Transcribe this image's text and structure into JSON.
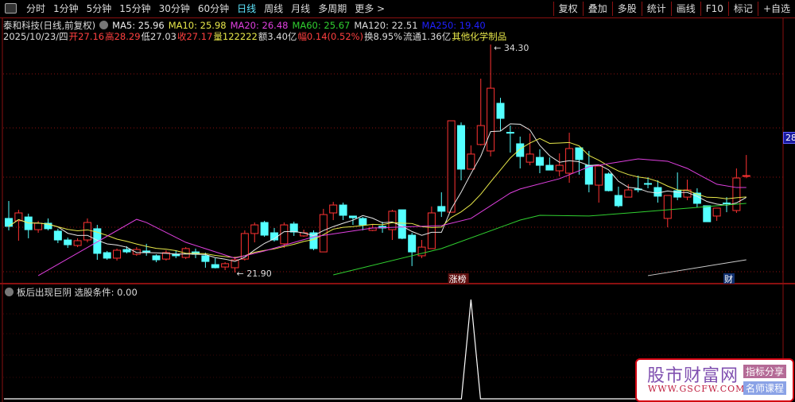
{
  "toolbar": {
    "tabs": [
      "分时",
      "1分钟",
      "5分钟",
      "15分钟",
      "30分钟",
      "60分钟",
      "日线",
      "周线",
      "月线",
      "多周期",
      "更多 >"
    ],
    "active_tab": "日线",
    "right_buttons": [
      "复权",
      "叠加",
      "多股",
      "统计",
      "画线",
      "F10",
      "标记",
      "+自选"
    ]
  },
  "header": {
    "title": "泰和科技(日线,前复权)",
    "ma5": "MA5: 25.96",
    "ma10": "MA10: 25.98",
    "ma20": "MA20: 26.48",
    "ma60": "MA60: 25.67",
    "ma120": "MA120: 22.51",
    "ma250": "MA250: 19.40",
    "date": "2025/10/23/四",
    "open": "开27.16",
    "high": "高28.29",
    "low": "低27.03",
    "close": "收27.17",
    "volume": "量122222",
    "amount": "额3.40亿",
    "change": "幅0.14(0.52%)",
    "turnover": "换8.95%",
    "float": "流通1.36亿",
    "industry": "其他化学制品"
  },
  "colors": {
    "up": "#ff3333",
    "down": "#54ffff",
    "ma5": "#e8e8e8",
    "ma10": "#e8e84a",
    "ma20": "#e040e0",
    "ma60": "#30d030",
    "ma120": "#cccccc",
    "ma250": "#2020ff",
    "grid": "#8a1010"
  },
  "chart_data": {
    "type": "candlestick",
    "price_labels": {
      "max": "34.30",
      "min": "21.90"
    },
    "current_price_tag": "28.",
    "candles": [
      [
        24.84,
        25.79,
        24.19,
        24.41
      ],
      [
        24.71,
        25.31,
        23.63,
        25.14
      ],
      [
        24.92,
        25.1,
        23.76,
        24.23
      ],
      [
        24.23,
        24.71,
        24.06,
        24.58
      ],
      [
        24.58,
        24.84,
        24.19,
        24.28
      ],
      [
        24.15,
        24.28,
        23.5,
        23.67
      ],
      [
        23.67,
        23.8,
        23.24,
        23.41
      ],
      [
        23.37,
        23.76,
        23.28,
        23.63
      ],
      [
        23.67,
        24.84,
        23.54,
        24.62
      ],
      [
        24.28,
        24.49,
        22.59,
        22.94
      ],
      [
        22.98,
        23.07,
        22.59,
        22.68
      ],
      [
        22.68,
        23.2,
        22.55,
        23.11
      ],
      [
        23.15,
        23.33,
        22.94,
        23.02
      ],
      [
        22.89,
        23.28,
        22.81,
        23.15
      ],
      [
        23.07,
        23.46,
        22.81,
        22.98
      ],
      [
        22.81,
        22.89,
        22.46,
        22.59
      ],
      [
        22.63,
        23.11,
        22.55,
        22.98
      ],
      [
        22.89,
        23.11,
        22.68,
        22.81
      ],
      [
        22.72,
        23.28,
        22.63,
        23.2
      ],
      [
        23.02,
        23.2,
        22.68,
        22.89
      ],
      [
        22.81,
        22.98,
        22.16,
        22.5
      ],
      [
        22.33,
        22.68,
        22.12,
        22.16
      ],
      [
        22.2,
        22.46,
        22.03,
        22.38
      ],
      [
        22.16,
        22.76,
        21.9,
        22.59
      ],
      [
        22.63,
        24.19,
        22.55,
        24.02
      ],
      [
        24.02,
        24.62,
        23.54,
        24.49
      ],
      [
        24.62,
        24.71,
        23.84,
        23.93
      ],
      [
        24.06,
        24.32,
        23.58,
        23.67
      ],
      [
        23.46,
        24.62,
        23.24,
        24.49
      ],
      [
        24.54,
        24.66,
        23.89,
        24.1
      ],
      [
        23.89,
        24.23,
        23.84,
        24.06
      ],
      [
        24.06,
        24.19,
        23.11,
        23.2
      ],
      [
        23.02,
        25.36,
        23.02,
        25.05
      ],
      [
        25.14,
        25.74,
        24.75,
        25.57
      ],
      [
        25.57,
        25.7,
        24.75,
        25.01
      ],
      [
        24.97,
        24.97,
        24.49,
        24.88
      ],
      [
        24.84,
        24.92,
        24.19,
        24.49
      ],
      [
        24.19,
        24.49,
        24.15,
        24.32
      ],
      [
        24.41,
        24.66,
        24.06,
        24.32
      ],
      [
        24.23,
        25.31,
        23.67,
        25.23
      ],
      [
        25.31,
        25.31,
        23.71,
        23.76
      ],
      [
        23.93,
        24.06,
        22.25,
        23.02
      ],
      [
        22.81,
        23.67,
        22.68,
        23.28
      ],
      [
        23.2,
        25.49,
        23.2,
        25.14
      ],
      [
        25.49,
        26.26,
        24.92,
        25.23
      ],
      [
        25.18,
        30.15,
        25.18,
        30.15
      ],
      [
        29.89,
        30.06,
        26.91,
        27.52
      ],
      [
        27.52,
        28.81,
        27.52,
        28.34
      ],
      [
        28.86,
        32.44,
        28.81,
        29.89
      ],
      [
        28.51,
        34.3,
        28.21,
        31.92
      ],
      [
        31.1,
        31.4,
        29.59,
        30.28
      ],
      [
        29.52,
        29.89,
        28.42,
        29.5
      ],
      [
        28.9,
        29.29,
        27.56,
        28.21
      ],
      [
        27.9,
        29.46,
        27.73,
        28.34
      ],
      [
        28.16,
        28.6,
        27.3,
        27.73
      ],
      [
        27.73,
        28.16,
        27.47,
        27.47
      ],
      [
        27.43,
        28.38,
        27.13,
        27.73
      ],
      [
        27.3,
        29.5,
        26.78,
        28.64
      ],
      [
        28.68,
        28.68,
        27.22,
        28.04
      ],
      [
        27.73,
        28.51,
        26.26,
        26.7
      ],
      [
        26.65,
        27.69,
        25.7,
        27.69
      ],
      [
        27.26,
        27.34,
        26.31,
        26.35
      ],
      [
        26.09,
        26.57,
        25.44,
        25.53
      ],
      [
        26.0,
        26.7,
        26.0,
        26.39
      ],
      [
        26.44,
        27.17,
        26.26,
        26.42
      ],
      [
        26.74,
        27.08,
        26.48,
        26.72
      ],
      [
        26.52,
        26.91,
        25.7,
        26.05
      ],
      [
        24.84,
        26.09,
        24.36,
        26.09
      ],
      [
        26.35,
        27.34,
        25.83,
        26.0
      ],
      [
        26.0,
        26.95,
        25.83,
        26.39
      ],
      [
        26.22,
        26.48,
        25.44,
        25.66
      ],
      [
        25.53,
        25.53,
        24.66,
        24.66
      ],
      [
        24.97,
        25.4,
        24.71,
        25.4
      ],
      [
        25.68,
        26.0,
        25.18,
        25.66
      ],
      [
        25.27,
        27.56,
        25.14,
        27.04
      ],
      [
        27.16,
        28.29,
        27.03,
        27.17
      ]
    ],
    "candle_format": [
      "open",
      "high",
      "low",
      "close"
    ],
    "ma20_points": [
      [
        3,
        21.73
      ],
      [
        13,
        24.79
      ],
      [
        14,
        24.62
      ],
      [
        18,
        23.54
      ],
      [
        23,
        22.68
      ],
      [
        26,
        23.07
      ],
      [
        31,
        23.84
      ],
      [
        37,
        24.32
      ],
      [
        44,
        24.45
      ],
      [
        47,
        24.84
      ],
      [
        51,
        26.22
      ],
      [
        52,
        26.44
      ],
      [
        56,
        27.0
      ],
      [
        59,
        27.65
      ],
      [
        64,
        28.08
      ],
      [
        67,
        27.95
      ],
      [
        69,
        27.56
      ],
      [
        72,
        26.7
      ],
      [
        74,
        26.52
      ],
      [
        75,
        26.52
      ]
    ],
    "ma60_points": [
      [
        33,
        21.77
      ],
      [
        44,
        23.2
      ],
      [
        52,
        24.75
      ],
      [
        54,
        25.01
      ],
      [
        59,
        24.97
      ],
      [
        64,
        25.18
      ],
      [
        75,
        25.66
      ]
    ],
    "ma120_points": [
      [
        65,
        21.73
      ],
      [
        75,
        22.59
      ]
    ],
    "markers": [
      {
        "index": 45,
        "label": "涨榜"
      },
      {
        "index": 73,
        "label": "财"
      }
    ],
    "indicator": {
      "name": "板后出现巨阴",
      "label": "选股条件: 0.00",
      "spike_index": 47,
      "values_nonzero": {
        "47": 1
      }
    }
  },
  "watermark": {
    "name": "股市财富网",
    "url": "WWW.GSCFW.COM",
    "badge1": "指标分享",
    "badge2": "名师课程"
  }
}
